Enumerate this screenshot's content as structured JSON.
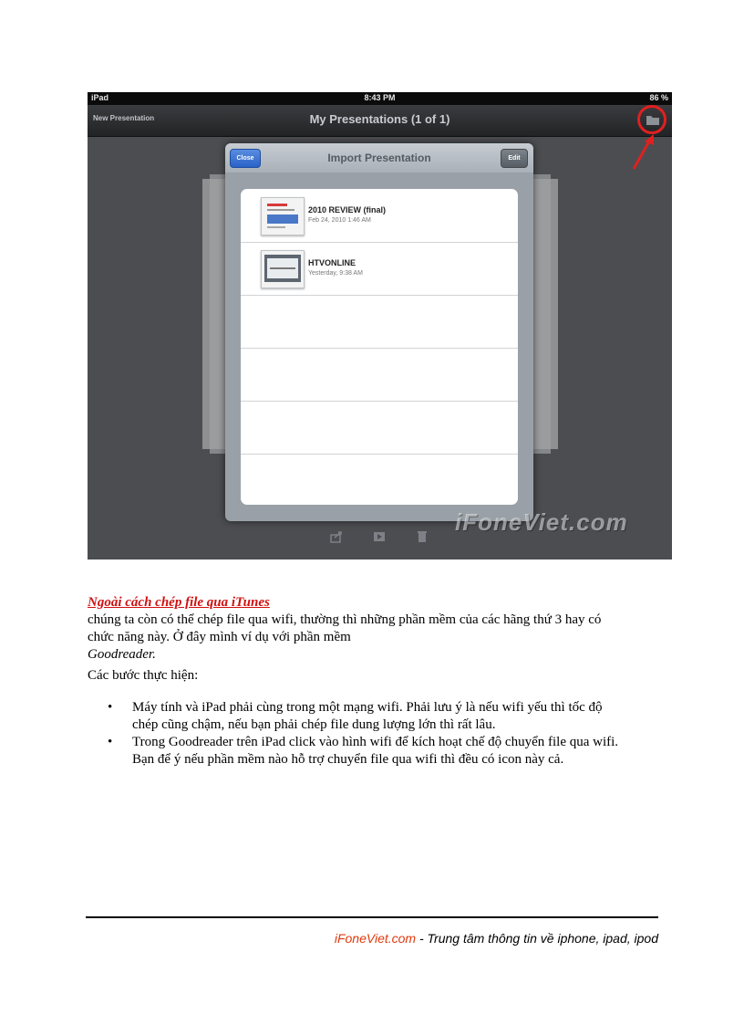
{
  "screenshot": {
    "status_left": "iPad",
    "status_time": "8:43 PM",
    "status_battery": "86 %",
    "nav_back": "New Presentation",
    "nav_title": "My Presentations (1 of 1)",
    "popover": {
      "close_label": "Close",
      "title": "Import Presentation",
      "edit_label": "Edit",
      "items": [
        {
          "name": "2010 REVIEW (final)",
          "date": "Feb 24, 2010 1:46 AM"
        },
        {
          "name": "HTVONLINE",
          "date": "Yesterday, 9:38 AM"
        }
      ]
    },
    "watermark": "iFoneViet.com",
    "icons": [
      "folder-icon",
      "share-icon",
      "play-icon",
      "trash-icon"
    ],
    "highlight_color": "#e02020"
  },
  "body": {
    "link_heading": "Ngoài cách chép file qua iTunes",
    "para_line1": "chúng ta còn có thể chép file qua wifi, thường thì những phần mềm của các hãng thứ 3 hay có",
    "para_line2": "chức năng này. Ở đây mình ví dụ với phần mềm",
    "para_line3": "Goodreader.",
    "steps_label": "Các bước thực hiện:",
    "steps": [
      {
        "line1": "Máy tính và iPad phải cùng trong một mạng wifi. Phải lưu ý là nếu wifi yếu thì tốc độ",
        "line2": "chép cũng chậm, nếu bạn phải chép file dung lượng lớn thì rất lâu."
      },
      {
        "line1": "Trong Goodreader trên iPad click vào hình wifi để kích hoạt chế độ chuyển file qua wifi.",
        "line2": "Bạn để ý nếu phần mềm nào hỗ trợ chuyển file qua wifi thì đều có icon này cả."
      }
    ]
  },
  "footer": {
    "brand": "iFoneViet.com",
    "tagline": " -  Trung tâm thông tin về iphone, ipad, ipod"
  }
}
